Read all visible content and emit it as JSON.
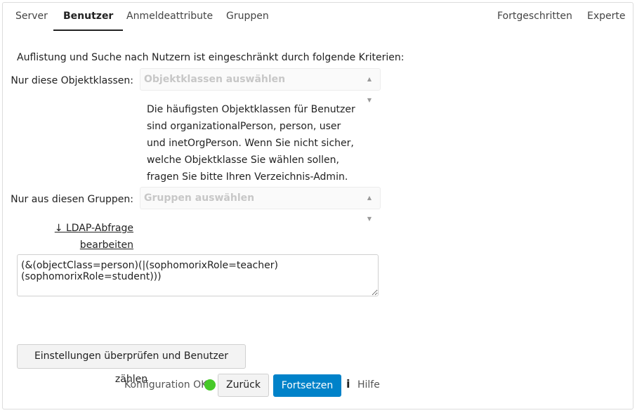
{
  "tabs": {
    "server": "Server",
    "users": "Benutzer",
    "login_attributes": "Anmeldeattribute",
    "groups": "Gruppen",
    "advanced": "Fortgeschritten",
    "expert": "Experte"
  },
  "intro_text": "Auflistung und Suche nach Nutzern ist eingeschränkt durch folgende Kriterien:",
  "object_classes": {
    "label": "Nur diese Objektklassen:",
    "placeholder": "Objektklassen auswählen"
  },
  "help_text": "Die häufigsten Objektklassen für Benutzer sind organizationalPerson, person, user und inetOrgPerson. Wenn Sie nicht sicher, welche Objektklasse Sie wählen sollen, fragen Sie bitte Ihren Verzeichnis-Admin.",
  "groups": {
    "label": "Nur aus diesen Gruppen:",
    "placeholder": "Gruppen auswählen"
  },
  "ldap_link": {
    "arrow": "↓",
    "line1": "LDAP-Abfrage",
    "line2": "bearbeiten"
  },
  "ldap_filter": "(&(objectClass=person)(|(sophomorixRole=teacher)(sophomorixRole=student)))",
  "buttons": {
    "check_count": "Einstellungen überprüfen und Benutzer zählen",
    "back": "Zurück",
    "continue": "Fortsetzen"
  },
  "status": {
    "text": "Konfiguration OK",
    "color": "#46c928"
  },
  "help_link": "Hilfe",
  "accent_color": "#0082c9"
}
